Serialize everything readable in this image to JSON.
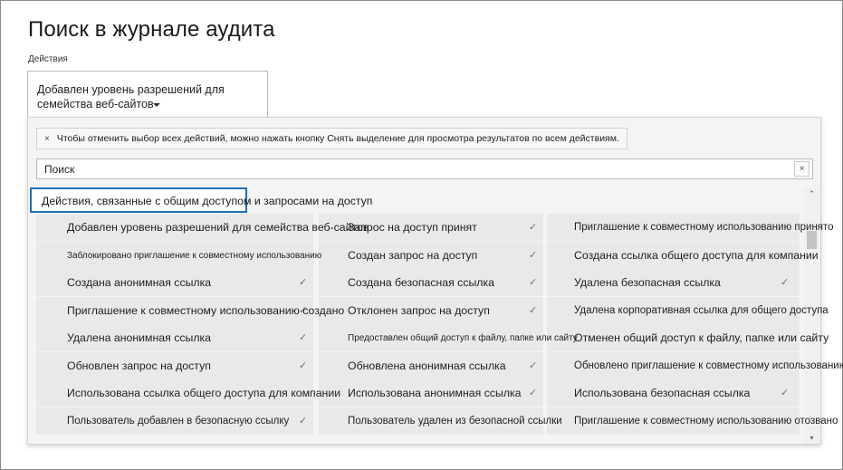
{
  "page": {
    "title": "Поиск в журнале аудита"
  },
  "activities": {
    "label": "Действия",
    "selected_value": "Добавлен уровень разрешений для семейства веб-сайтов"
  },
  "dropdown": {
    "hint_text": "Чтобы отменить выбор всех действий, можно нажать кнопку Снять выделение для просмотра результатов по всем действиям.",
    "hint_close": "×",
    "search_value": "Поиск",
    "search_clear": "×",
    "group_title": "Действия, связанные с общим доступом и запросами на доступ",
    "check_glyph": "✓",
    "scroll_up": "⌃",
    "scroll_down": "▾",
    "columns": [
      {
        "items": [
          "Добавлен уровень разрешений для семейства веб-сайтов",
          "Заблокировано приглашение к совместному использованию",
          "Создана анонимная ссылка",
          "Приглашение к совместному использованию создано",
          "Удалена анонимная ссылка",
          "Обновлен запрос на доступ",
          "Использована ссылка общего доступа для компании",
          "Пользователь добавлен в безопасную ссылку"
        ]
      },
      {
        "items": [
          "Запрос на доступ принят",
          "Создан запрос на доступ",
          "Создана безопасная ссылка",
          "Отклонен запрос на доступ",
          "Предоставлен общий доступ к файлу, папке или сайту",
          "Обновлена анонимная ссылка",
          "Использована анонимная ссылка",
          "Пользователь удален из безопасной ссылки"
        ]
      },
      {
        "items": [
          "Приглашение к совместному использованию принято",
          "Создана ссылка общего доступа для компании",
          "Удалена безопасная ссылка",
          "Удалена корпоративная ссылка для общего доступа",
          "Отменен общий доступ к файлу, папке или сайту",
          "Обновлено приглашение к совместному использованию",
          "Использована безопасная ссылка",
          "Приглашение к совместному использованию отозвано"
        ]
      }
    ]
  }
}
